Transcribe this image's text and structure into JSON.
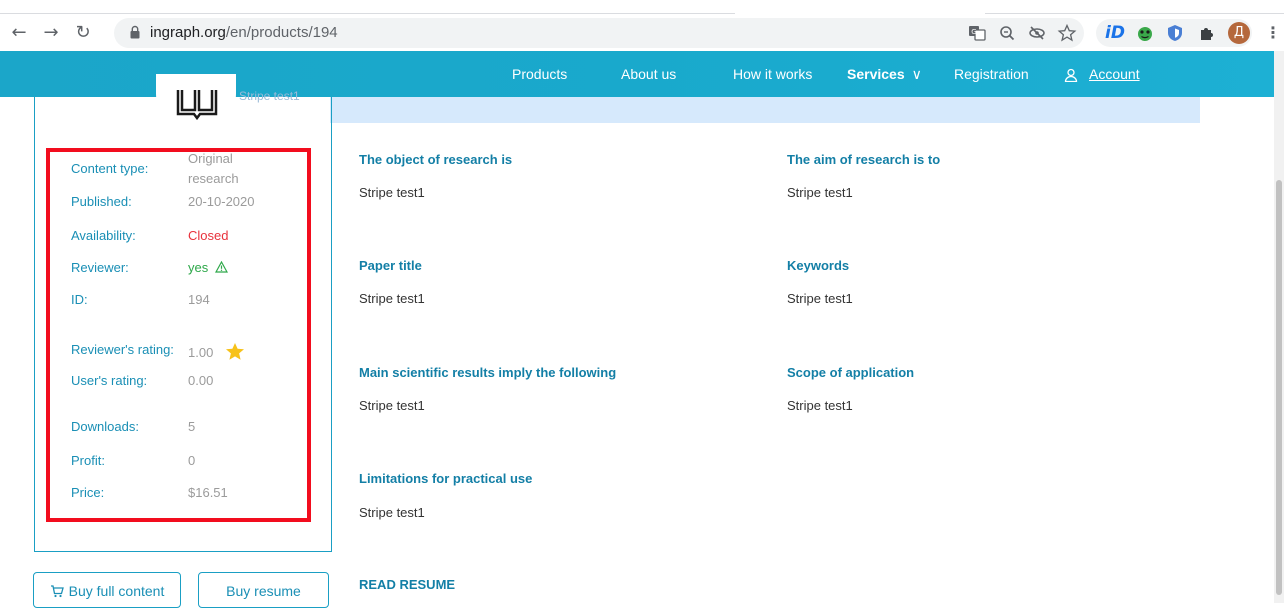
{
  "browser": {
    "url_host": "ingraph.org",
    "url_path": "/en/products/194",
    "avatar_letter": "Д"
  },
  "nav": {
    "products": "Products",
    "about": "About us",
    "how": "How it works",
    "services": "Services",
    "registration": "Registration",
    "account": "Account"
  },
  "product": {
    "banner_text": "Stripe test1"
  },
  "details": {
    "content_type_label": "Content type:",
    "content_type_value_1": "Original",
    "content_type_value_2": "research",
    "published_label": "Published:",
    "published_value": "20-10-2020",
    "availability_label": "Availability:",
    "availability_value": "Closed",
    "reviewer_label": "Reviewer:",
    "reviewer_value": "yes",
    "id_label": "ID:",
    "id_value": "194",
    "reviewer_rating_label": "Reviewer's rating:",
    "reviewer_rating_value": "1.00",
    "user_rating_label": "User's rating:",
    "user_rating_value": "0.00",
    "downloads_label": "Downloads:",
    "downloads_value": "5",
    "profit_label": "Profit:",
    "profit_value": "0",
    "price_label": "Price:",
    "price_value": "$16.51"
  },
  "sections": {
    "object_title": "The object of research is",
    "object_text": "Stripe test1",
    "aim_title": "The aim of research is to",
    "aim_text": "Stripe test1",
    "paper_title": "Paper title",
    "paper_text": "Stripe test1",
    "keywords_title": "Keywords",
    "keywords_text": "Stripe test1",
    "results_title": "Main scientific results imply the following",
    "results_text": "Stripe test1",
    "scope_title": "Scope of application",
    "scope_text": "Stripe test1",
    "limitations_title": "Limitations for practical use",
    "limitations_text": "Stripe test1",
    "read_resume": "READ RESUME"
  },
  "buttons": {
    "buy_full": "Buy full content",
    "buy_resume": "Buy resume"
  },
  "colors": {
    "accent": "#1a9fc4",
    "highlight_box": "#f20d1e",
    "closed": "#e8323c",
    "reviewer_yes": "#2ea84a"
  }
}
